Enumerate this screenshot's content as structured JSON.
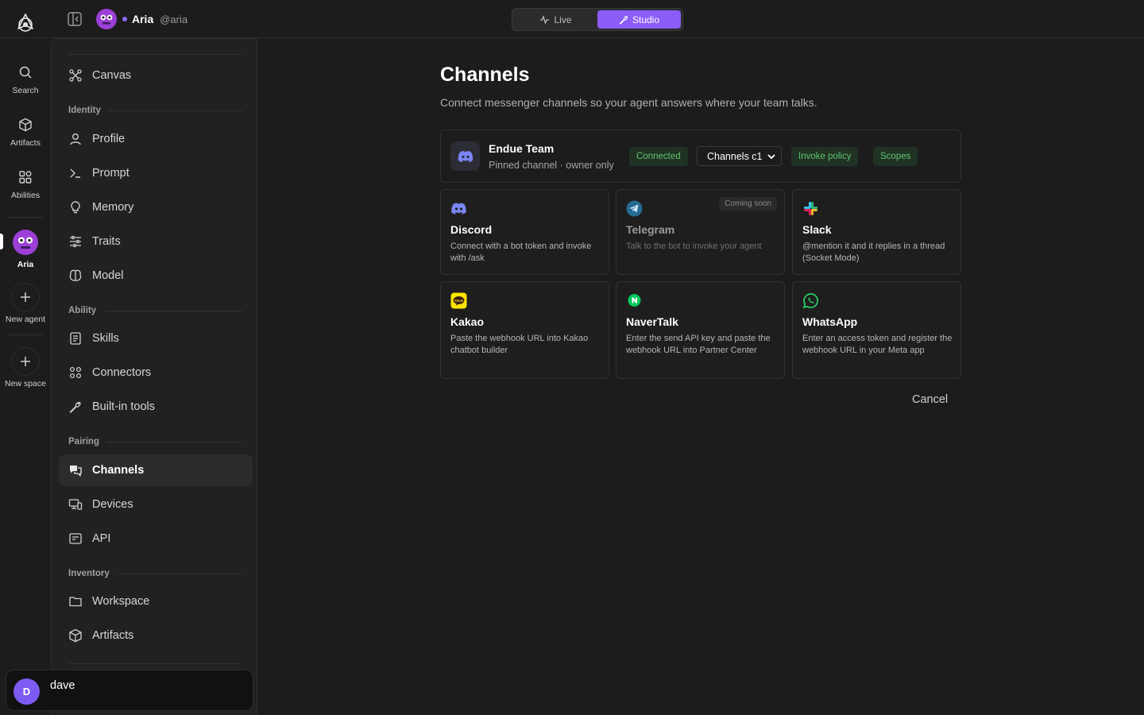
{
  "topbar": {
    "agent_name": "Aria",
    "agent_handle": "@aria",
    "modes": [
      {
        "label": "Live",
        "active": false
      },
      {
        "label": "Studio",
        "active": true
      }
    ]
  },
  "rail": {
    "items": [
      {
        "label": "Search",
        "icon": "search-icon"
      },
      {
        "label": "Artifacts",
        "icon": "cube-icon"
      },
      {
        "label": "Abilities",
        "icon": "grid-icon"
      },
      {
        "label": "Aria",
        "icon": "agent-avatar",
        "active": true
      },
      {
        "label": "New agent",
        "icon": "plus-icon"
      },
      {
        "label": "New space",
        "icon": "plus-icon"
      }
    ]
  },
  "sidebar": {
    "top_item": "Canvas",
    "sections": [
      {
        "title": "Identity",
        "items": [
          "Profile",
          "Prompt",
          "Memory",
          "Traits",
          "Model"
        ]
      },
      {
        "title": "Ability",
        "items": [
          "Skills",
          "Connectors",
          "Built-in tools"
        ]
      },
      {
        "title": "Pairing",
        "items": [
          "Channels",
          "Devices",
          "API"
        ]
      },
      {
        "title": "Inventory",
        "items": [
          "Workspace",
          "Artifacts"
        ]
      }
    ],
    "active_item": "Channels",
    "user": {
      "initial": "D",
      "name": "dave"
    }
  },
  "main": {
    "title": "Channels",
    "subtitle": "Connect messenger channels so your agent answers where your team talks.",
    "connected": {
      "name": "Endue Team",
      "sub": "Pinned channel · owner only",
      "status": "Connected",
      "channel_select": "Channels c1",
      "invoke_label": "Invoke policy",
      "scopes_label": "Scopes"
    },
    "channels": [
      {
        "name": "Discord",
        "desc": "Connect with a bot token and invoke with /ask",
        "icon": "discord-icon"
      },
      {
        "name": "Telegram",
        "desc": "Talk to the bot to invoke your agent",
        "icon": "telegram-icon",
        "badge": "Coming soon"
      },
      {
        "name": "Slack",
        "desc": "@mention it and it replies in a thread (Socket Mode)",
        "icon": "slack-icon"
      },
      {
        "name": "Kakao",
        "desc": "Paste the webhook URL into Kakao chatbot builder",
        "icon": "kakao-icon"
      },
      {
        "name": "NaverTalk",
        "desc": "Enter the send API key and paste the webhook URL into Partner Center",
        "icon": "navertalk-icon"
      },
      {
        "name": "WhatsApp",
        "desc": "Enter an access token and register the webhook URL in your Meta app",
        "icon": "whatsapp-icon"
      }
    ],
    "cancel_label": "Cancel"
  },
  "colors": {
    "accent": "#8b5cf6",
    "success": "#5fc46f",
    "background": "#1c1c1c",
    "sidebar": "#212121"
  }
}
